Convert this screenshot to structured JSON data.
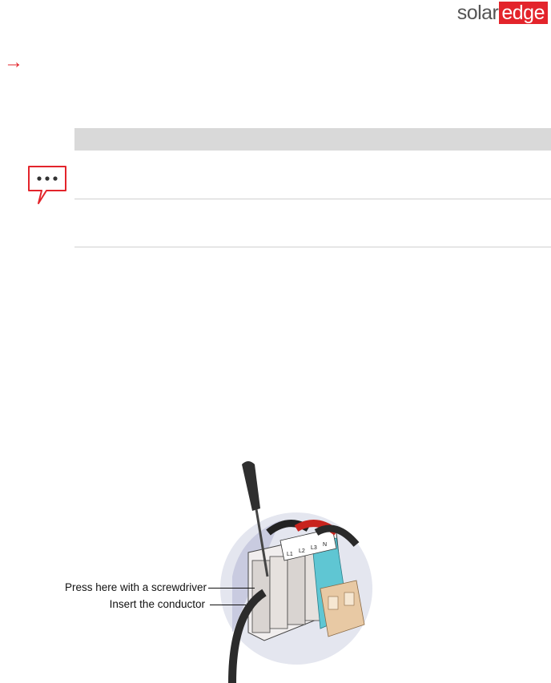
{
  "header": {
    "logo_solar": "solar",
    "logo_edge": "edge",
    "brand_color": "#e3242b"
  },
  "step_arrow": "→",
  "note": {
    "icon": "note-speech-bubble-icon"
  },
  "figure": {
    "icons": [
      "screwdriver-icon",
      "terminal-block-icon"
    ],
    "callout_press": "Press here with a screwdriver",
    "callout_insert": "Insert the conductor",
    "terminal_labels": [
      "L1",
      "L2",
      "L3",
      "N"
    ]
  }
}
